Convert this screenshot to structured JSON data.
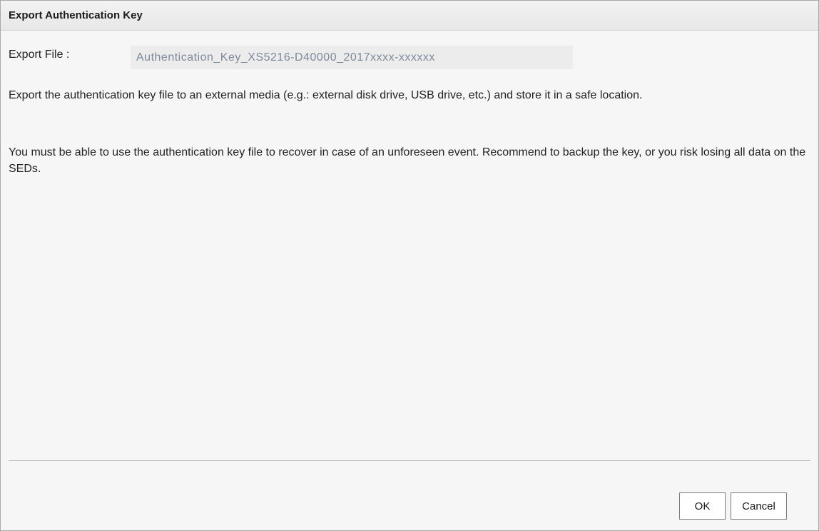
{
  "dialog": {
    "title": "Export Authentication Key",
    "export_file_label": "Export File :",
    "export_file_value": "Authentication_Key_XS5216-D40000_2017xxxx-xxxxxx",
    "paragraphs": [
      "Export the authentication key file to an external media (e.g.: external disk drive, USB drive, etc.) and store it in a safe location.",
      "You must be able to use the authentication key file to recover in case of an unforeseen event. Recommend to backup the key, or you risk losing all data on the SEDs."
    ],
    "buttons": {
      "ok_label": "OK",
      "cancel_label": "Cancel"
    }
  }
}
